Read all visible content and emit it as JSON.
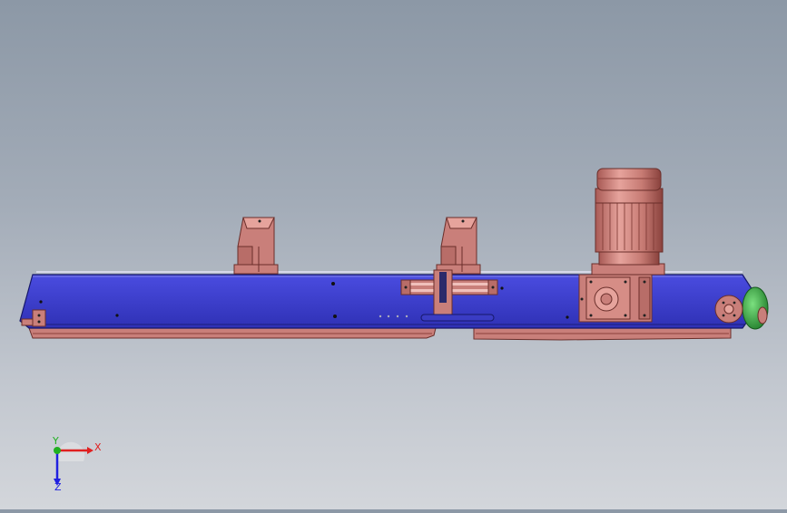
{
  "viewport": {
    "colors": {
      "bg_top": "#8c98a6",
      "bg_bottom": "#d3d6db",
      "frame": "#3a3cc4",
      "frame_dark": "#23258a",
      "parts": "#c97f7a",
      "parts_dark": "#8a3f3a",
      "roller": "#3fb84a"
    }
  },
  "triad": {
    "x_label": "X",
    "y_label": "Y",
    "z_label": "Z",
    "colors": {
      "x": "#e02020",
      "y": "#20b020",
      "z": "#2020e0"
    }
  }
}
